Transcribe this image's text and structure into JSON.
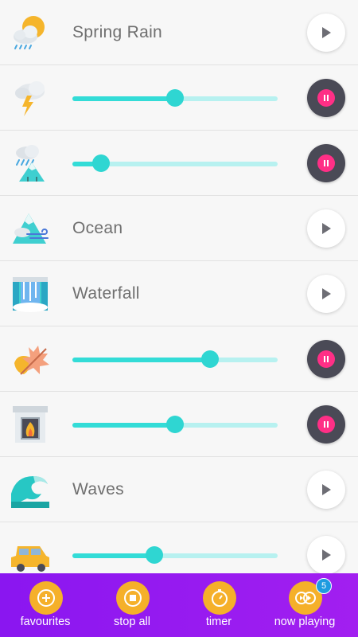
{
  "sounds": [
    {
      "name": "Spring Rain",
      "icon": "sun-cloud-rain-icon",
      "playing": false
    },
    {
      "name": "Thunder",
      "icon": "thunderstorm-icon",
      "playing": true,
      "volume": 0.5
    },
    {
      "name": "Mountain Rain",
      "icon": "rain-mountain-icon",
      "playing": true,
      "volume": 0.14
    },
    {
      "name": "Ocean",
      "icon": "ocean-wind-icon",
      "playing": false
    },
    {
      "name": "Waterfall",
      "icon": "waterfall-icon",
      "playing": false
    },
    {
      "name": "Autumn Leaves",
      "icon": "leaves-icon",
      "playing": true,
      "volume": 0.67
    },
    {
      "name": "Fireplace",
      "icon": "fireplace-icon",
      "playing": true,
      "volume": 0.5
    },
    {
      "name": "Waves",
      "icon": "wave-icon",
      "playing": false
    },
    {
      "name": "Car",
      "icon": "car-icon",
      "playing": true,
      "volume": 0.4
    }
  ],
  "labels": {
    "spring_rain": "Spring Rain",
    "ocean": "Ocean",
    "waterfall": "Waterfall",
    "waves": "Waves"
  },
  "nav": {
    "favourites": "favourites",
    "stop_all": "stop all",
    "timer": "timer",
    "now_playing": "now playing",
    "now_playing_count": "5"
  },
  "colors": {
    "accent": "#33dcd7",
    "track": "#b7f1f0",
    "pause_button": "#4a4a56",
    "pause_dot": "#ff2f86",
    "bottom_bar": "#9a1cf0",
    "nav_circle": "#f5b02a",
    "badge": "#1e9be0"
  }
}
